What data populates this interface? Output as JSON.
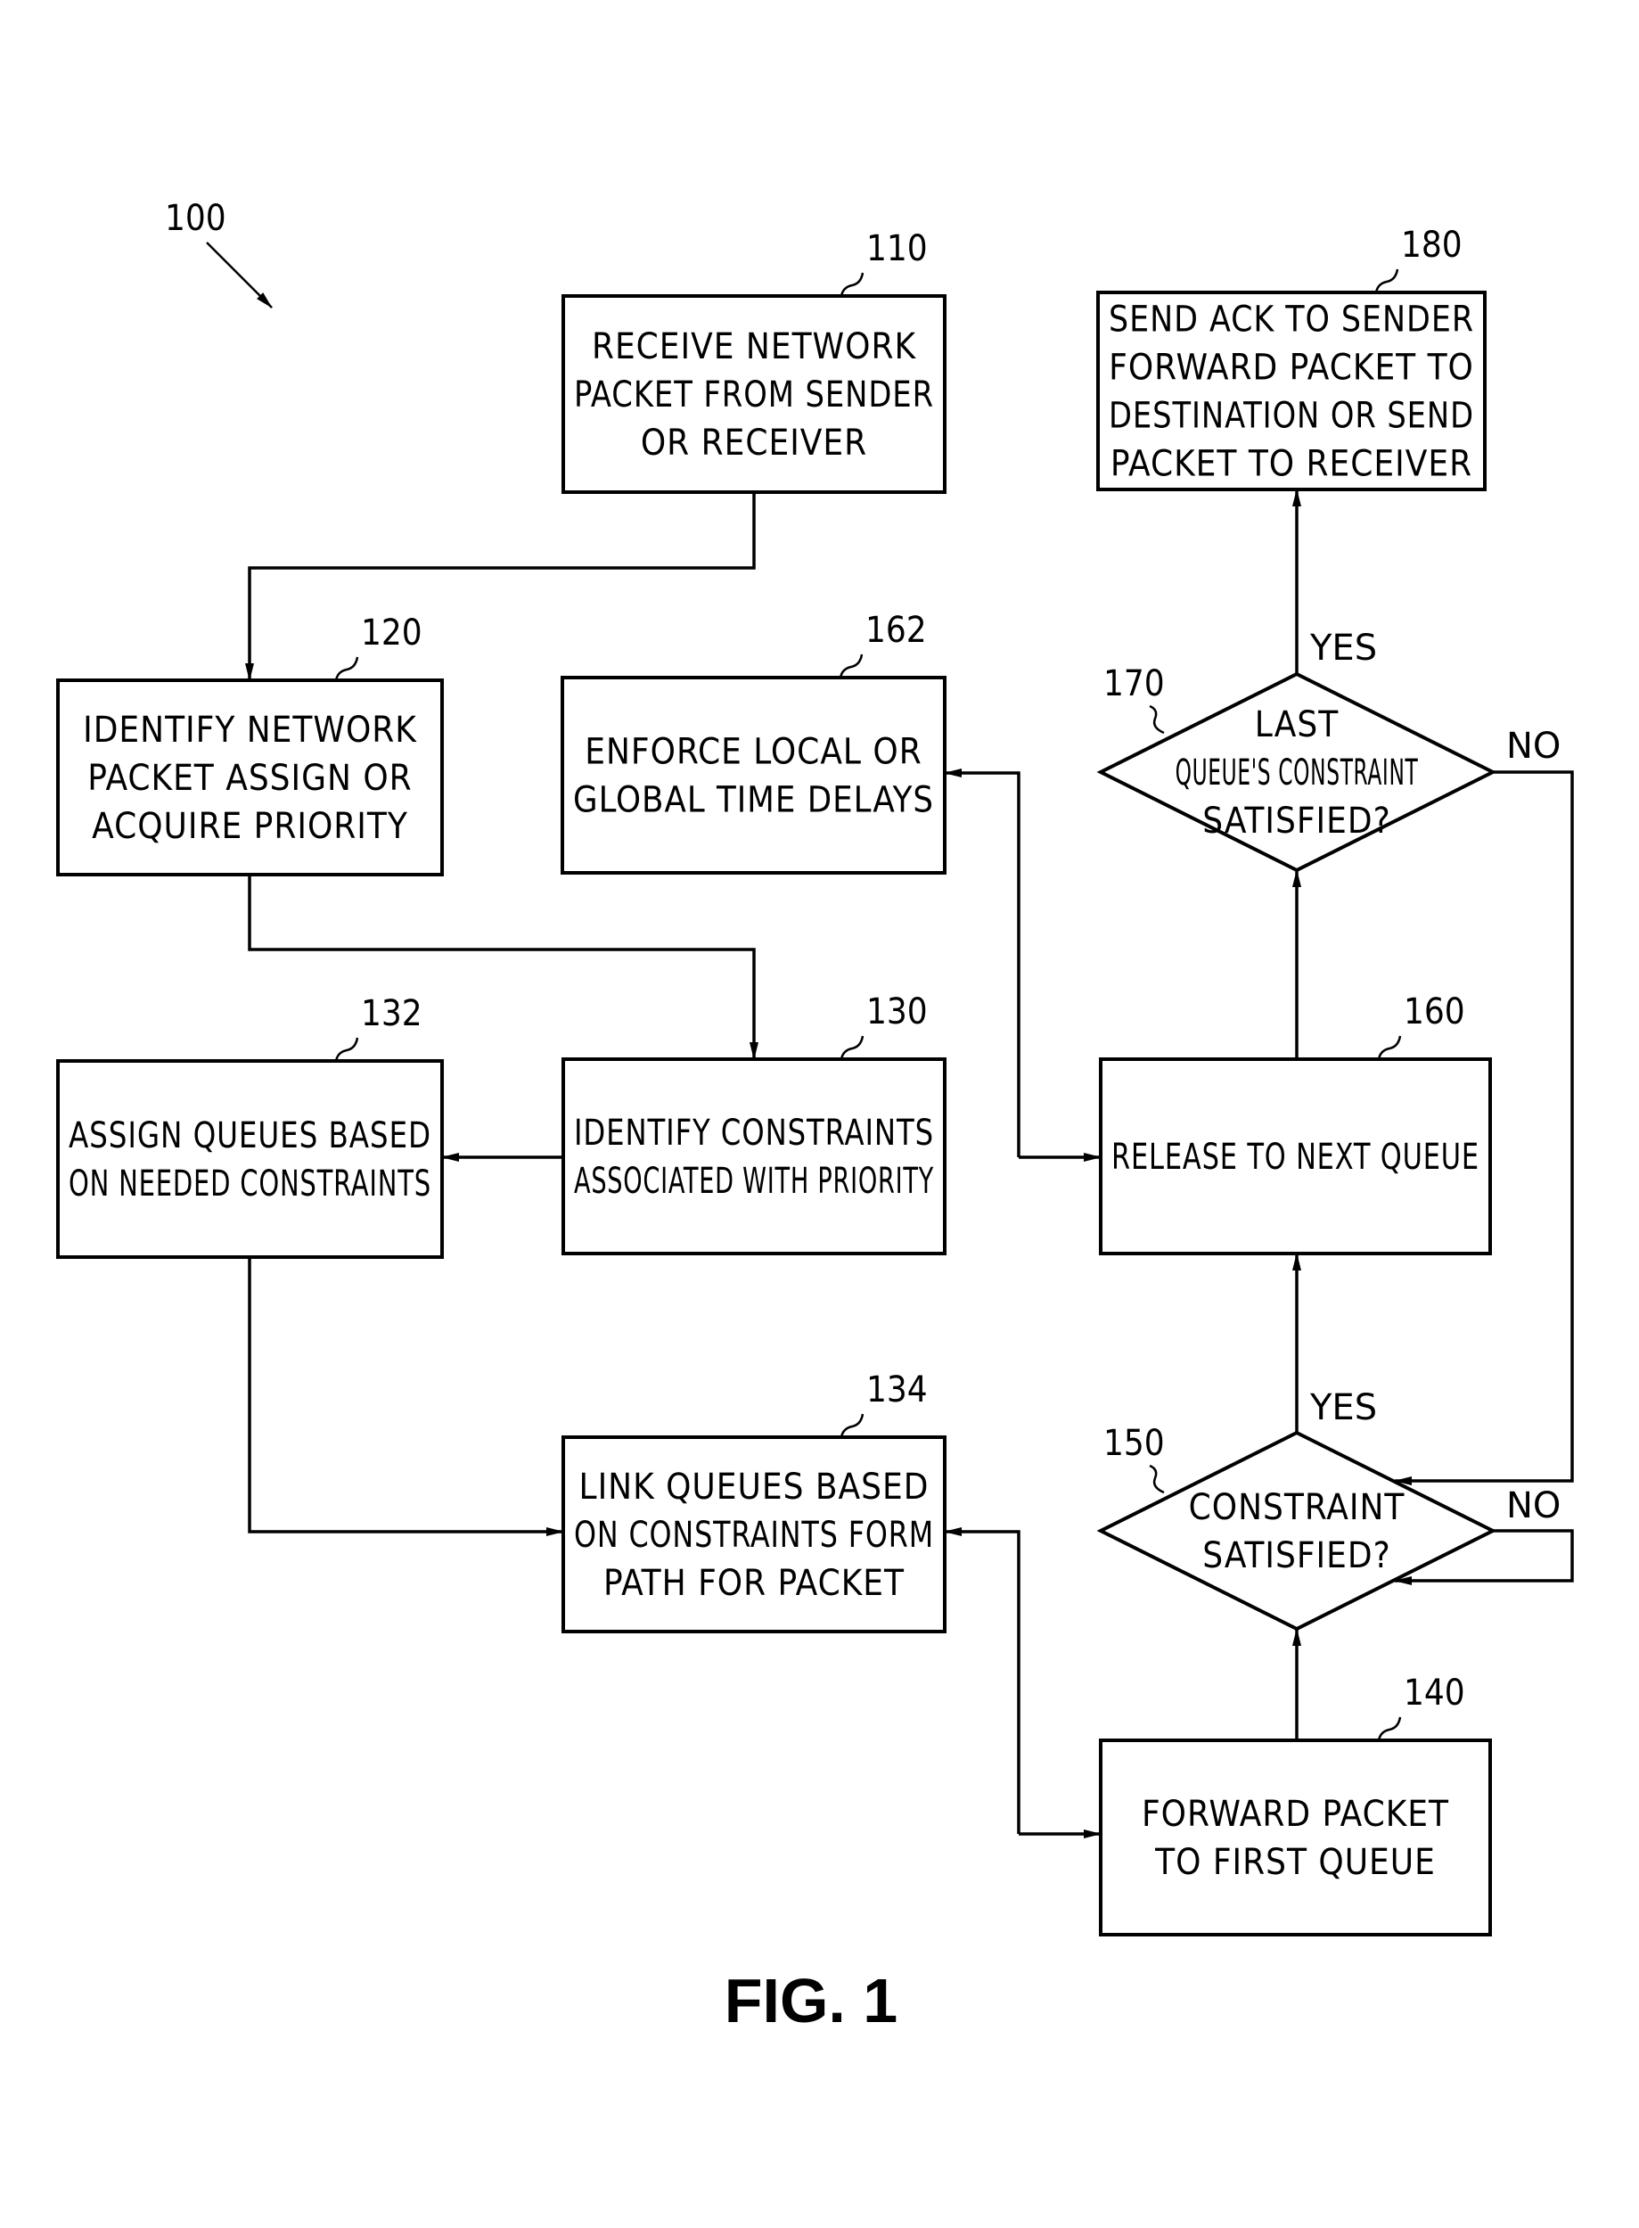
{
  "figure": {
    "reference": "100",
    "caption": "FIG. 1"
  },
  "nodes": [
    {
      "id": "110",
      "kind": "process",
      "lines": [
        "RECEIVE NETWORK",
        "PACKET FROM SENDER",
        "OR RECEIVER"
      ]
    },
    {
      "id": "120",
      "kind": "process",
      "lines": [
        "IDENTIFY NETWORK",
        "PACKET ASSIGN OR",
        "ACQUIRE PRIORITY"
      ]
    },
    {
      "id": "130",
      "kind": "process",
      "lines": [
        "IDENTIFY CONSTRAINTS",
        "ASSOCIATED WITH PRIORITY"
      ]
    },
    {
      "id": "132",
      "kind": "process",
      "lines": [
        "ASSIGN QUEUES BASED",
        "ON NEEDED CONSTRAINTS"
      ]
    },
    {
      "id": "134",
      "kind": "process",
      "lines": [
        "LINK QUEUES BASED",
        "ON CONSTRAINTS FORM",
        "PATH FOR PACKET"
      ]
    },
    {
      "id": "140",
      "kind": "process",
      "lines": [
        "FORWARD PACKET",
        "TO FIRST QUEUE"
      ]
    },
    {
      "id": "150",
      "kind": "decision",
      "lines": [
        "CONSTRAINT",
        "SATISFIED?"
      ]
    },
    {
      "id": "160",
      "kind": "process",
      "lines": [
        "RELEASE TO NEXT QUEUE"
      ]
    },
    {
      "id": "162",
      "kind": "process",
      "lines": [
        "ENFORCE LOCAL OR",
        "GLOBAL TIME DELAYS"
      ]
    },
    {
      "id": "170",
      "kind": "decision",
      "lines": [
        "LAST",
        "QUEUE'S CONSTRAINT",
        "SATISFIED?"
      ]
    },
    {
      "id": "180",
      "kind": "process",
      "lines": [
        "SEND ACK TO SENDER",
        "FORWARD PACKET TO",
        "DESTINATION OR SEND",
        "PACKET TO RECEIVER"
      ]
    }
  ],
  "edges": [
    {
      "from": "110",
      "to": "120",
      "label": ""
    },
    {
      "from": "120",
      "to": "130",
      "label": ""
    },
    {
      "from": "130",
      "to": "132",
      "label": ""
    },
    {
      "from": "132",
      "to": "134",
      "label": ""
    },
    {
      "from": "134",
      "to": "140",
      "label": "",
      "bidirectional": true
    },
    {
      "from": "140",
      "to": "150",
      "label": ""
    },
    {
      "from": "150",
      "to": "160",
      "label": "YES"
    },
    {
      "from": "150",
      "to": "150",
      "label": "NO"
    },
    {
      "from": "160",
      "to": "162",
      "label": "",
      "bidirectional": true
    },
    {
      "from": "160",
      "to": "170",
      "label": ""
    },
    {
      "from": "170",
      "to": "180",
      "label": "YES"
    },
    {
      "from": "170",
      "to": "150",
      "label": "NO"
    }
  ],
  "branch_labels": {
    "yes": "YES",
    "no": "NO"
  }
}
